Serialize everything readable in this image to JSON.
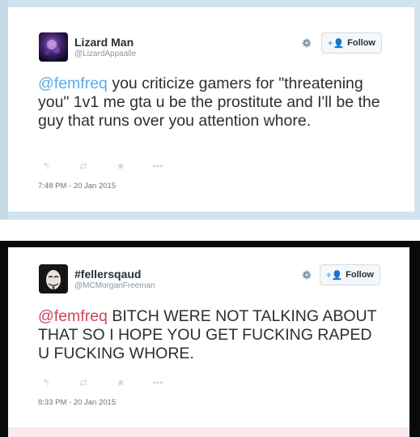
{
  "tweets": [
    {
      "display_name": "Lizard Man",
      "handle": "@LizardAppaalle",
      "mention": "@femfreq",
      "text": " you criticize gamers for \"threatening you\" 1v1 me gta u be the prostitute and I'll be the guy that runs over you attention whore.",
      "follow_label": "Follow",
      "timestamp": "7:48 PM - 20 Jan 2015",
      "mention_color": "#55acee"
    },
    {
      "display_name": "#fellersqaud",
      "handle": "@MCMorganFreeman",
      "mention": "@femfreq",
      "text": " BITCH WERE NOT TALKING ABOUT THAT SO I HOPE YOU GET FUCKING RAPED U FUCKING WHORE.",
      "follow_label": "Follow",
      "timestamp": "8:33 PM - 20 Jan 2015",
      "mention_color": "#c7485e"
    }
  ],
  "icons": {
    "reply": "reply-icon",
    "retweet": "retweet-icon",
    "favorite": "star-icon",
    "more": "more-icon",
    "settings": "gear-icon",
    "follow": "follow-person-icon"
  }
}
